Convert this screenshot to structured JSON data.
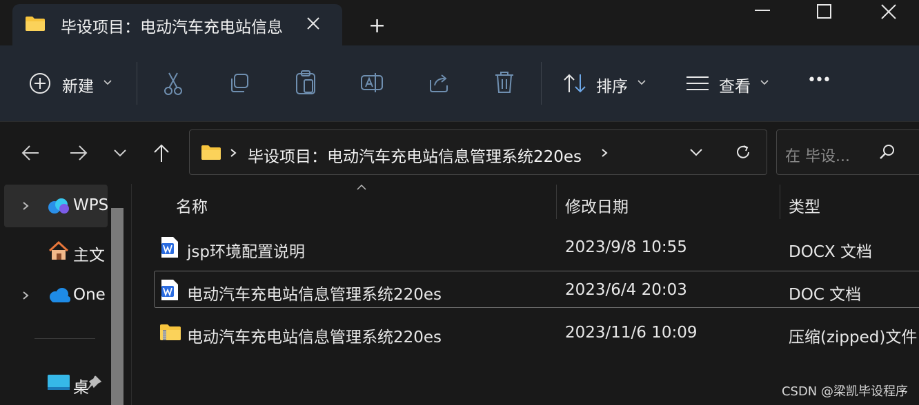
{
  "window": {
    "tab_title": "毕设项目：电动汽车充电站信息",
    "add_tab": "+"
  },
  "toolbar": {
    "new_label": "新建",
    "sort_label": "排序",
    "view_label": "查看",
    "more_label": "•••"
  },
  "address": {
    "path": "毕设项目：电动汽车充电站信息管理系统220es",
    "search_placeholder": "在 毕设..."
  },
  "sidebar": {
    "items": [
      {
        "label": "WPS"
      },
      {
        "label": "主文"
      },
      {
        "label": "One"
      },
      {
        "label": "桌"
      }
    ]
  },
  "list": {
    "columns": [
      "名称",
      "修改日期",
      "类型"
    ],
    "rows": [
      {
        "name": "jsp环境配置说明",
        "date": "2023/9/8 10:55",
        "type": "DOCX 文档"
      },
      {
        "name": "电动汽车充电站信息管理系统220es",
        "date": "2023/6/4 20:03",
        "type": "DOC 文档"
      },
      {
        "name": "电动汽车充电站信息管理系统220es",
        "date": "2023/11/6 10:09",
        "type": "压缩(zipped)文件"
      }
    ]
  },
  "watermark": "CSDN @梁凯毕设程序",
  "colors": {
    "accent": "#f7c43d",
    "word_blue": "#2b6ce0",
    "onedrive_blue": "#1e8be6"
  }
}
